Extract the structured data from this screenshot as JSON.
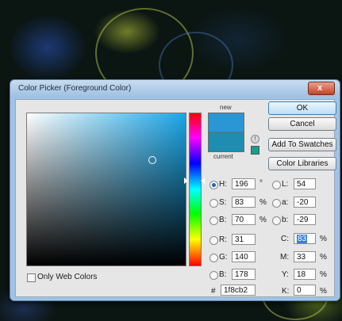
{
  "window": {
    "title": "Color Picker (Foreground Color)",
    "close_label": "x"
  },
  "swatches": {
    "new_label": "new",
    "current_label": "current",
    "new_color": "#2b96d4",
    "current_color": "#1f8cb2"
  },
  "buttons": {
    "ok": "OK",
    "cancel": "Cancel",
    "add_to_swatches": "Add To Swatches",
    "color_libraries": "Color Libraries"
  },
  "hsb": {
    "h": {
      "label": "H:",
      "value": "196",
      "unit": "°"
    },
    "s": {
      "label": "S:",
      "value": "83",
      "unit": "%"
    },
    "b": {
      "label": "B:",
      "value": "70",
      "unit": "%"
    }
  },
  "rgb": {
    "r": {
      "label": "R:",
      "value": "31"
    },
    "g": {
      "label": "G:",
      "value": "140"
    },
    "b": {
      "label": "B:",
      "value": "178"
    }
  },
  "lab": {
    "l": {
      "label": "L:",
      "value": "54"
    },
    "a": {
      "label": "a:",
      "value": "-20"
    },
    "b": {
      "label": "b:",
      "value": "-29"
    }
  },
  "cmyk": {
    "c": {
      "label": "C:",
      "value": "83",
      "unit": "%"
    },
    "m": {
      "label": "M:",
      "value": "33",
      "unit": "%"
    },
    "y": {
      "label": "Y:",
      "value": "18",
      "unit": "%"
    },
    "k": {
      "label": "K:",
      "value": "0",
      "unit": "%"
    }
  },
  "hex": {
    "label": "#",
    "value": "1f8cb2"
  },
  "only_web_colors": {
    "label": "Only Web Colors",
    "checked": false
  },
  "selected_mode": "H",
  "icons": {
    "gamut_warning": "warning-icon",
    "web_safe": "cube-icon"
  }
}
